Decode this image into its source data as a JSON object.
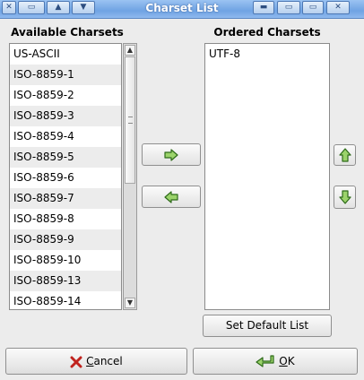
{
  "window": {
    "title": "Charset List"
  },
  "titlebar": {
    "left_buttons": [
      {
        "glyph": "✕"
      },
      {
        "glyph": "▭"
      },
      {
        "glyph": "▲"
      },
      {
        "glyph": "▼"
      }
    ],
    "right_buttons": [
      {
        "glyph": "▬"
      },
      {
        "glyph": "▭"
      },
      {
        "glyph": "✕"
      }
    ]
  },
  "available": {
    "label": "Available Charsets",
    "items": [
      "US-ASCII",
      "ISO-8859-1",
      "ISO-8859-2",
      "ISO-8859-3",
      "ISO-8859-4",
      "ISO-8859-5",
      "ISO-8859-6",
      "ISO-8859-7",
      "ISO-8859-8",
      "ISO-8859-9",
      "ISO-8859-10",
      "ISO-8859-13",
      "ISO-8859-14"
    ]
  },
  "ordered": {
    "label": "Ordered Charsets",
    "items": [
      "UTF-8"
    ]
  },
  "buttons": {
    "add_icon": "right-arrow-icon",
    "remove_icon": "left-arrow-icon",
    "up_icon": "up-arrow-icon",
    "down_icon": "down-arrow-icon",
    "set_default": "Set Default List",
    "cancel_prefix": "",
    "cancel_mnemonic": "C",
    "cancel_rest": "ancel",
    "ok_mnemonic": "O",
    "ok_rest": "K"
  },
  "colors": {
    "titlebar": "#7fb0ea",
    "accent_green": "#2e6b1a",
    "cancel_red": "#c0231e"
  }
}
